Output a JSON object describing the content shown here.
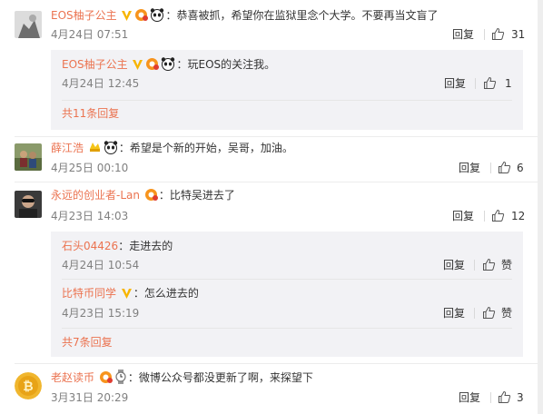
{
  "comments": [
    {
      "username": "EOS柚子公主",
      "text": "：恭喜被抓，希望你在监狱里念个大学。不要再当文盲了",
      "time": "4月24日 07:51",
      "reply_label": "回复",
      "likes": "31",
      "replies": [
        {
          "username": "EOS柚子公主",
          "text": "：玩EOS的关注我。",
          "time": "4月24日 12:45",
          "reply_label": "回复",
          "likes": "1"
        }
      ],
      "more_replies": "共11条回复"
    },
    {
      "username": "薛江浩",
      "text": "：希望是个新的开始，吴哥，加油。",
      "time": "4月25日 00:10",
      "reply_label": "回复",
      "likes": "6"
    },
    {
      "username": "永远的创业者-Lan",
      "text": "：比特吴进去了",
      "time": "4月23日 14:03",
      "reply_label": "回复",
      "likes": "12",
      "replies": [
        {
          "username": "石头04426",
          "text": "：走进去的",
          "time": "4月24日 10:54",
          "reply_label": "回复",
          "likes": "赞"
        },
        {
          "username": "比特币同学",
          "text": "：怎么进去的",
          "time": "4月23日 15:19",
          "reply_label": "回复",
          "likes": "赞"
        }
      ],
      "more_replies": "共7条回复"
    },
    {
      "username": "老赵读币",
      "text": "：微博公众号都没更新了啊，来探望下",
      "time": "3月31日 20:29",
      "reply_label": "回复",
      "likes": "3"
    }
  ],
  "colors": {
    "username": "#eb7350",
    "meta": "#808080",
    "reply_bg": "#f2f2f5",
    "verified": "#f7b500"
  },
  "icons": [
    "verified-v-icon",
    "vip-badge-icon",
    "panda-emoji-icon",
    "thumbs-up-icon",
    "bitcoin-avatar",
    "wristwatch-emoji-icon",
    "gold-badge-icon"
  ]
}
